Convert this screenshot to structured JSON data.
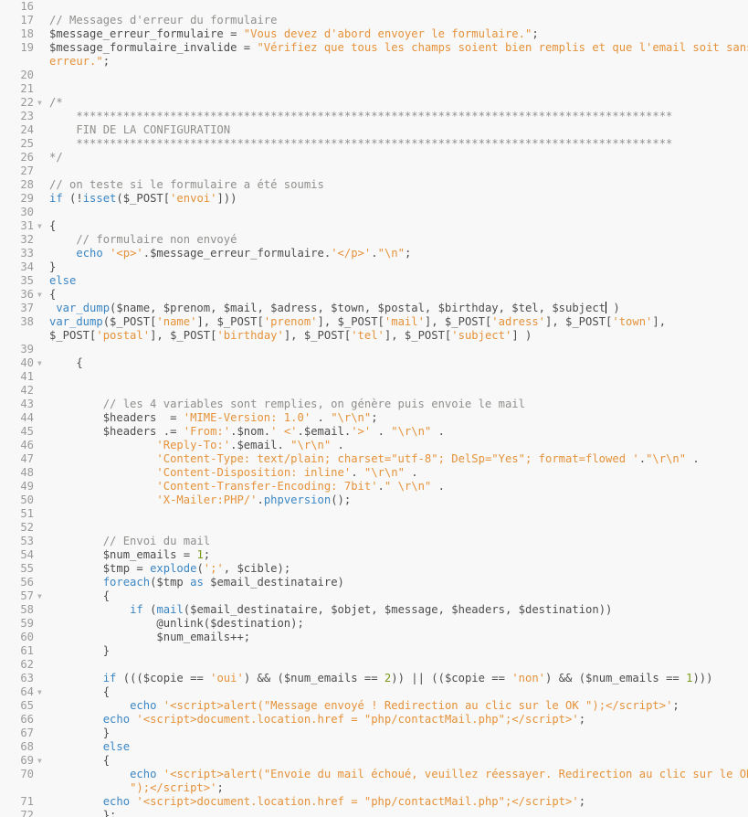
{
  "editor": {
    "language": "php",
    "colors": {
      "background": "#f8f8f8",
      "text": "#4d4d4d",
      "comment": "#8e908c",
      "string": "#e5923a",
      "keyword": "#3b86c4",
      "number": "#7a9a1a",
      "gutter": "#9a9a9a"
    },
    "fold_icon": "triangle-down-icon"
  },
  "lines": [
    {
      "n": "16",
      "seg": []
    },
    {
      "n": "17",
      "seg": [
        [
          "c",
          "// Messages d'erreur du formulaire"
        ]
      ]
    },
    {
      "n": "18",
      "seg": [
        [
          "",
          "$message_erreur_formulaire = "
        ],
        [
          "s",
          "\"Vous devez d'abord envoyer le formulaire.\""
        ],
        [
          "",
          ";"
        ]
      ]
    },
    {
      "n": "19",
      "seg": [
        [
          "",
          "$message_formulaire_invalide = "
        ],
        [
          "s",
          "\"Vérifiez que tous les champs soient bien remplis et que l'email soit sans"
        ]
      ]
    },
    {
      "n": "",
      "seg": [
        [
          "s",
          "erreur.\""
        ],
        [
          "",
          ";"
        ]
      ]
    },
    {
      "n": "20",
      "seg": []
    },
    {
      "n": "21",
      "seg": []
    },
    {
      "n": "22",
      "fold": true,
      "seg": [
        [
          "c",
          "/*"
        ]
      ]
    },
    {
      "n": "23",
      "seg": [
        [
          "c",
          "    *****************************************************************************************"
        ]
      ]
    },
    {
      "n": "24",
      "seg": [
        [
          "c",
          "    FIN DE LA CONFIGURATION"
        ]
      ]
    },
    {
      "n": "25",
      "seg": [
        [
          "c",
          "    *****************************************************************************************"
        ]
      ]
    },
    {
      "n": "26",
      "seg": [
        [
          "c",
          "*/"
        ]
      ]
    },
    {
      "n": "27",
      "seg": []
    },
    {
      "n": "28",
      "seg": [
        [
          "c",
          "// on teste si le formulaire a été soumis"
        ]
      ]
    },
    {
      "n": "29",
      "seg": [
        [
          "k",
          "if"
        ],
        [
          "",
          " (!"
        ],
        [
          "k",
          "isset"
        ],
        [
          "",
          "($_POST["
        ],
        [
          "s",
          "'envoi'"
        ],
        [
          "",
          "]))"
        ]
      ]
    },
    {
      "n": "30",
      "seg": []
    },
    {
      "n": "31",
      "fold": true,
      "seg": [
        [
          "",
          "{"
        ]
      ]
    },
    {
      "n": "32",
      "seg": [
        [
          "c",
          "    // formulaire non envoyé"
        ]
      ]
    },
    {
      "n": "33",
      "seg": [
        [
          "",
          "    "
        ],
        [
          "k",
          "echo"
        ],
        [
          "",
          " "
        ],
        [
          "s",
          "'<p>'"
        ],
        [
          "",
          ".$message_erreur_formulaire."
        ],
        [
          "s",
          "'</p>'"
        ],
        [
          "",
          "."
        ],
        [
          "s",
          "\"\\n\""
        ],
        [
          "",
          ";"
        ]
      ]
    },
    {
      "n": "34",
      "seg": [
        [
          "",
          "}"
        ]
      ]
    },
    {
      "n": "35",
      "seg": [
        [
          "k",
          "else"
        ]
      ]
    },
    {
      "n": "36",
      "fold": true,
      "seg": [
        [
          "",
          "{"
        ]
      ]
    },
    {
      "n": "37",
      "caret": true,
      "seg": [
        [
          "",
          " "
        ],
        [
          "k",
          "var_dump"
        ],
        [
          "",
          "($name, $prenom, $mail, $adress, $town, $postal, $birthday, $tel, $subject"
        ]
      ],
      "tail": " )"
    },
    {
      "n": "38",
      "seg": [
        [
          "k",
          "var_dump"
        ],
        [
          "",
          "($_POST["
        ],
        [
          "s",
          "'name'"
        ],
        [
          "",
          "], $_POST["
        ],
        [
          "s",
          "'prenom'"
        ],
        [
          "",
          "], $_POST["
        ],
        [
          "s",
          "'mail'"
        ],
        [
          "",
          "], $_POST["
        ],
        [
          "s",
          "'adress'"
        ],
        [
          "",
          "], $_POST["
        ],
        [
          "s",
          "'town'"
        ],
        [
          "",
          "],"
        ]
      ]
    },
    {
      "n": "",
      "seg": [
        [
          "",
          "$_POST["
        ],
        [
          "s",
          "'postal'"
        ],
        [
          "",
          "], $_POST["
        ],
        [
          "s",
          "'birthday'"
        ],
        [
          "",
          "], $_POST["
        ],
        [
          "s",
          "'tel'"
        ],
        [
          "",
          "], $_POST["
        ],
        [
          "s",
          "'subject'"
        ],
        [
          "",
          "] )"
        ]
      ]
    },
    {
      "n": "39",
      "seg": []
    },
    {
      "n": "40",
      "fold": true,
      "seg": [
        [
          "",
          "    {"
        ]
      ]
    },
    {
      "n": "41",
      "seg": []
    },
    {
      "n": "42",
      "seg": []
    },
    {
      "n": "43",
      "seg": [
        [
          "c",
          "        // les 4 variables sont remplies, on génère puis envoie le mail"
        ]
      ]
    },
    {
      "n": "44",
      "seg": [
        [
          "",
          "        $headers  = "
        ],
        [
          "s",
          "'MIME-Version: 1.0'"
        ],
        [
          "",
          " . "
        ],
        [
          "s",
          "\"\\r\\n\""
        ],
        [
          "",
          ";"
        ]
      ]
    },
    {
      "n": "45",
      "seg": [
        [
          "",
          "        $headers .= "
        ],
        [
          "s",
          "'From:'"
        ],
        [
          "",
          ".$nom."
        ],
        [
          "s",
          "' <'"
        ],
        [
          "",
          ".$email."
        ],
        [
          "s",
          "'>'"
        ],
        [
          "",
          " . "
        ],
        [
          "s",
          "\"\\r\\n\""
        ],
        [
          "",
          " ."
        ]
      ]
    },
    {
      "n": "46",
      "seg": [
        [
          "",
          "                "
        ],
        [
          "s",
          "'Reply-To:'"
        ],
        [
          "",
          ".$email. "
        ],
        [
          "s",
          "\"\\r\\n\""
        ],
        [
          "",
          " ."
        ]
      ]
    },
    {
      "n": "47",
      "seg": [
        [
          "",
          "                "
        ],
        [
          "s",
          "'Content-Type: text/plain; charset=\"utf-8\"; DelSp=\"Yes\"; format=flowed '"
        ],
        [
          "",
          "."
        ],
        [
          "s",
          "\"\\r\\n\""
        ],
        [
          "",
          " ."
        ]
      ]
    },
    {
      "n": "48",
      "seg": [
        [
          "",
          "                "
        ],
        [
          "s",
          "'Content-Disposition: inline'"
        ],
        [
          "",
          ". "
        ],
        [
          "s",
          "\"\\r\\n\""
        ],
        [
          "",
          " ."
        ]
      ]
    },
    {
      "n": "49",
      "seg": [
        [
          "",
          "                "
        ],
        [
          "s",
          "'Content-Transfer-Encoding: 7bit'"
        ],
        [
          "",
          "."
        ],
        [
          "s",
          "\" \\r\\n\""
        ],
        [
          "",
          " ."
        ]
      ]
    },
    {
      "n": "50",
      "seg": [
        [
          "",
          "                "
        ],
        [
          "s",
          "'X-Mailer:PHP/'"
        ],
        [
          "",
          "."
        ],
        [
          "k",
          "phpversion"
        ],
        [
          "",
          "();"
        ]
      ]
    },
    {
      "n": "51",
      "seg": []
    },
    {
      "n": "52",
      "seg": []
    },
    {
      "n": "53",
      "seg": [
        [
          "c",
          "        // Envoi du mail"
        ]
      ]
    },
    {
      "n": "54",
      "seg": [
        [
          "",
          "        $num_emails = "
        ],
        [
          "n",
          "1"
        ],
        [
          "",
          ";"
        ]
      ]
    },
    {
      "n": "55",
      "seg": [
        [
          "",
          "        $tmp = "
        ],
        [
          "k",
          "explode"
        ],
        [
          "",
          "("
        ],
        [
          "s",
          "';'"
        ],
        [
          "",
          ", $cible);"
        ]
      ]
    },
    {
      "n": "56",
      "seg": [
        [
          "",
          "        "
        ],
        [
          "k",
          "foreach"
        ],
        [
          "",
          "($tmp "
        ],
        [
          "k",
          "as"
        ],
        [
          "",
          " $email_destinataire)"
        ]
      ]
    },
    {
      "n": "57",
      "fold": true,
      "seg": [
        [
          "",
          "        {"
        ]
      ]
    },
    {
      "n": "58",
      "seg": [
        [
          "",
          "            "
        ],
        [
          "k",
          "if"
        ],
        [
          "",
          " ("
        ],
        [
          "k",
          "mail"
        ],
        [
          "",
          "($email_destinataire, $objet, $message, $headers, $destination))"
        ]
      ]
    },
    {
      "n": "59",
      "seg": [
        [
          "",
          "                @unlink($destination);"
        ]
      ]
    },
    {
      "n": "60",
      "seg": [
        [
          "",
          "                $num_emails++;"
        ]
      ]
    },
    {
      "n": "61",
      "seg": [
        [
          "",
          "        }"
        ]
      ]
    },
    {
      "n": "62",
      "seg": []
    },
    {
      "n": "63",
      "seg": [
        [
          "",
          "        "
        ],
        [
          "k",
          "if"
        ],
        [
          "",
          " ((($copie == "
        ],
        [
          "s",
          "'oui'"
        ],
        [
          "",
          ") && ($num_emails == "
        ],
        [
          "n",
          "2"
        ],
        [
          "",
          ")) || (($copie == "
        ],
        [
          "s",
          "'non'"
        ],
        [
          "",
          ") && ($num_emails == "
        ],
        [
          "n",
          "1"
        ],
        [
          "",
          ")))"
        ]
      ]
    },
    {
      "n": "64",
      "fold": true,
      "seg": [
        [
          "",
          "        {"
        ]
      ]
    },
    {
      "n": "65",
      "seg": [
        [
          "",
          "            "
        ],
        [
          "k",
          "echo"
        ],
        [
          "",
          " "
        ],
        [
          "s",
          "'<script>alert(\"Message envoyé ! Redirection au clic sur le OK \");</script>'"
        ],
        [
          "",
          ";"
        ]
      ]
    },
    {
      "n": "66",
      "seg": [
        [
          "",
          "        "
        ],
        [
          "k",
          "echo"
        ],
        [
          "",
          " "
        ],
        [
          "s",
          "'<script>document.location.href = \"php/contactMail.php\";</script>'"
        ],
        [
          "",
          ";"
        ]
      ]
    },
    {
      "n": "67",
      "seg": [
        [
          "",
          "        }"
        ]
      ]
    },
    {
      "n": "68",
      "seg": [
        [
          "",
          "        "
        ],
        [
          "k",
          "else"
        ]
      ]
    },
    {
      "n": "69",
      "fold": true,
      "seg": [
        [
          "",
          "        {"
        ]
      ]
    },
    {
      "n": "70",
      "seg": [
        [
          "",
          "            "
        ],
        [
          "k",
          "echo"
        ],
        [
          "",
          " "
        ],
        [
          "s",
          "'<script>alert(\"Envoie du mail échoué, veuillez réessayer. Redirection au clic sur le OK"
        ]
      ]
    },
    {
      "n": "",
      "seg": [
        [
          "",
          "            "
        ],
        [
          "s",
          "\");</script>'"
        ],
        [
          "",
          ";"
        ]
      ]
    },
    {
      "n": "71",
      "seg": [
        [
          "",
          "        "
        ],
        [
          "k",
          "echo"
        ],
        [
          "",
          " "
        ],
        [
          "s",
          "'<script>document.location.href = \"php/contactMail.php\";</script>'"
        ],
        [
          "",
          ";"
        ]
      ]
    },
    {
      "n": "72",
      "seg": [
        [
          "",
          "        };"
        ]
      ]
    }
  ]
}
